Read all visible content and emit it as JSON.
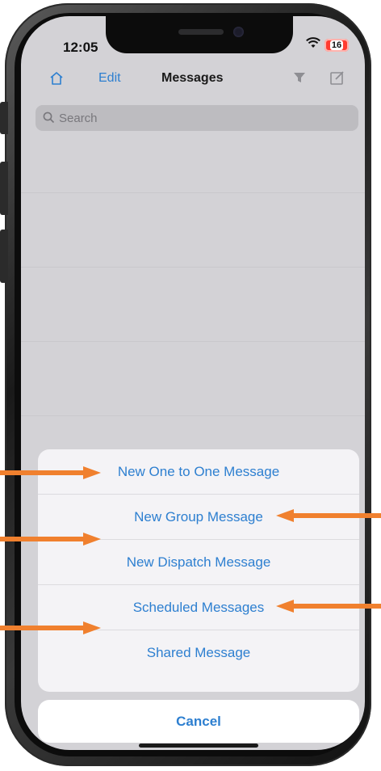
{
  "status_bar": {
    "time": "12:05",
    "battery": "16"
  },
  "nav": {
    "edit_label": "Edit",
    "title": "Messages"
  },
  "search": {
    "placeholder": "Search"
  },
  "action_sheet": {
    "items": [
      {
        "label": "New One to One Message"
      },
      {
        "label": "New Group Message"
      },
      {
        "label": "New Dispatch Message"
      },
      {
        "label": "Scheduled Messages"
      },
      {
        "label": "Shared Message"
      }
    ],
    "cancel_label": "Cancel"
  },
  "colors": {
    "accent": "#2d7fd0",
    "annotation_arrow": "#f0802e",
    "battery_low": "#ff3b30"
  },
  "icons": [
    "home-icon",
    "filter-icon",
    "compose-icon",
    "search-icon",
    "wifi-icon",
    "battery-icon",
    "arrow-icon"
  ]
}
